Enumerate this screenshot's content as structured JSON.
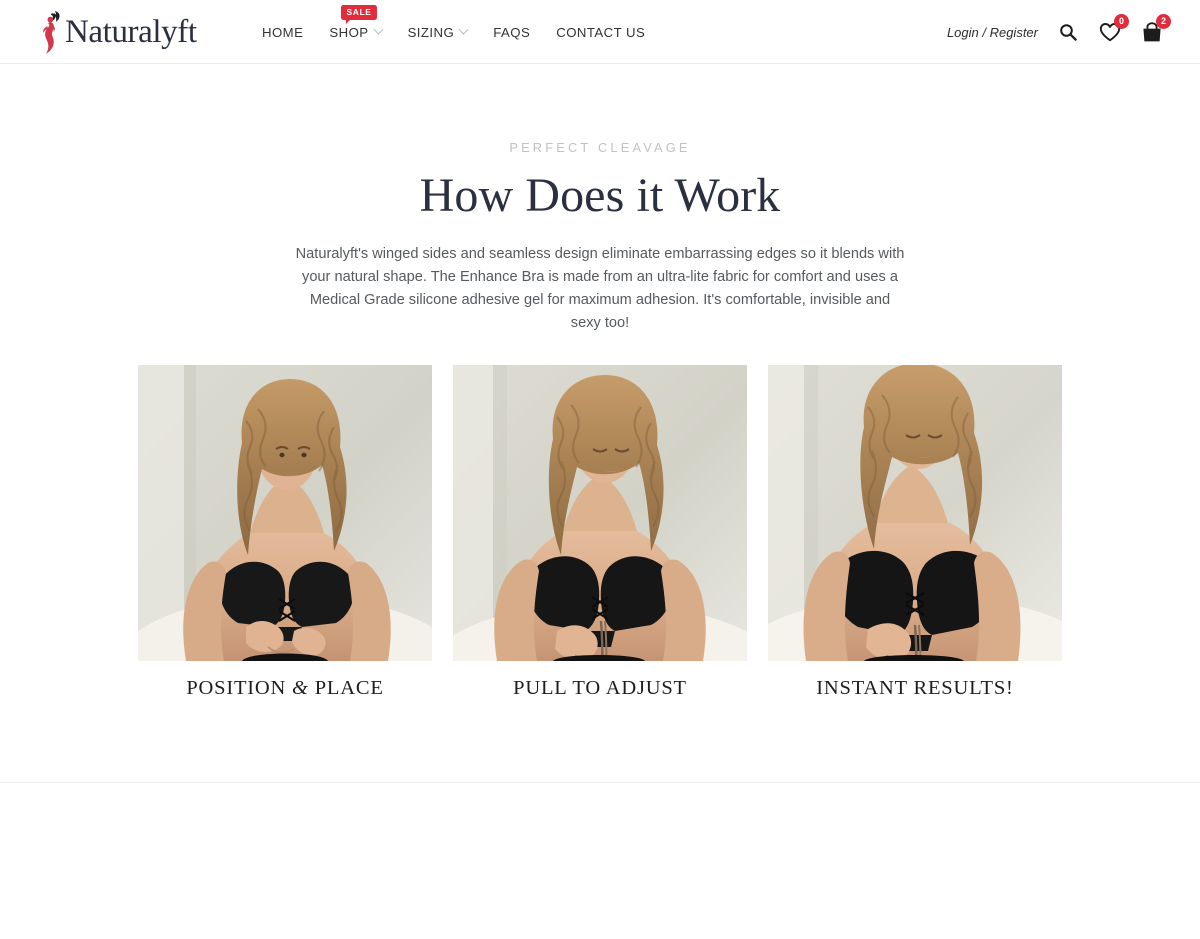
{
  "header": {
    "logo": {
      "word": "Naturalyft",
      "mark_name": "woman-silhouette-logo-icon",
      "mark_color": "#d2374a",
      "word_color": "#2b3040"
    },
    "nav": [
      {
        "label": "HOME",
        "has_caret": false,
        "badge": null
      },
      {
        "label": "SHOP",
        "has_caret": true,
        "badge": "SALE"
      },
      {
        "label": "SIZING",
        "has_caret": true,
        "badge": null
      },
      {
        "label": "FAQS",
        "has_caret": false,
        "badge": null
      },
      {
        "label": "CONTACT US",
        "has_caret": false,
        "badge": null
      }
    ],
    "tools": {
      "login_label": "Login / Register",
      "search_icon": "search-icon",
      "wishlist_icon": "heart-icon",
      "wishlist_count": "0",
      "cart_icon": "shopping-bag-icon",
      "cart_count": "2",
      "badge_color": "#e12c3c"
    }
  },
  "main": {
    "eyebrow": "PERFECT CLEAVAGE",
    "title": "How Does it Work",
    "description": "Naturalyft's winged sides and seamless design eliminate embarrassing edges so it blends with your natural shape. The Enhance Bra is made from an ultra-lite fabric for comfort and uses a Medical Grade silicone adhesive gel for maximum adhesion. It's comfortable, invisible and sexy too!",
    "steps": [
      {
        "caption_pre": "POSITION ",
        "caption_amp": "&",
        "caption_post": " PLACE",
        "photo_alt": "woman-positioning-adhesive-bra-photo"
      },
      {
        "caption_pre": "PULL TO ADJUST",
        "caption_amp": "",
        "caption_post": "",
        "photo_alt": "woman-pulling-bra-lace-photo"
      },
      {
        "caption_pre": "INSTANT RESULTS!",
        "caption_amp": "",
        "caption_post": "",
        "photo_alt": "woman-showing-lifted-result-photo"
      }
    ]
  }
}
